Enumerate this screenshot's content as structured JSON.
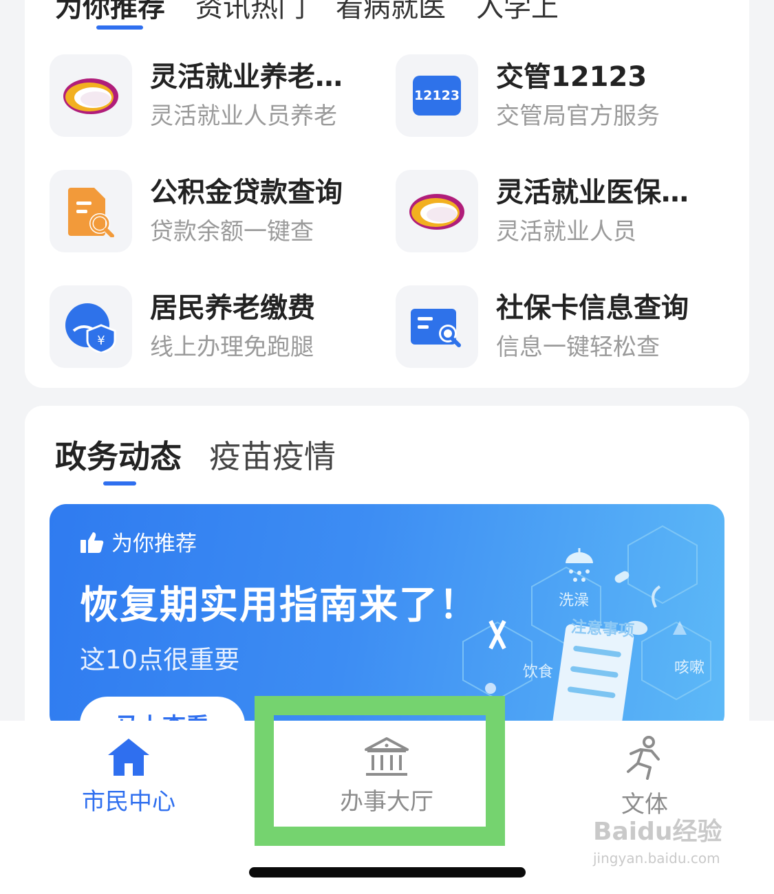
{
  "top_tabs": [
    {
      "label": "为你推荐",
      "active": true
    },
    {
      "label": "资讯热门",
      "active": false
    },
    {
      "label": "看病就医",
      "active": false
    },
    {
      "label": "入学上",
      "active": false
    }
  ],
  "services": [
    {
      "title": "灵活就业养老…",
      "subtitle": "灵活就业人员养老",
      "icon": "cloud-logo-icon"
    },
    {
      "title": "交管12123",
      "subtitle": "交管局官方服务",
      "icon": "traffic-12123-icon",
      "icon_text": "12123"
    },
    {
      "title": "公积金贷款查询",
      "subtitle": "贷款余额一键查",
      "icon": "document-search-icon"
    },
    {
      "title": "灵活就业医保…",
      "subtitle": "灵活就业人员",
      "icon": "cloud-logo-icon"
    },
    {
      "title": "居民养老缴费",
      "subtitle": "线上办理免跑腿",
      "icon": "elder-payment-icon"
    },
    {
      "title": "社保卡信息查询",
      "subtitle": "信息一键轻松查",
      "icon": "card-search-icon"
    }
  ],
  "news_tabs": [
    {
      "label": "政务动态",
      "active": true
    },
    {
      "label": "疫苗疫情",
      "active": false
    }
  ],
  "banner": {
    "recommend_label": "为你推荐",
    "title": "恢复期实用指南来了！",
    "subtitle": "这10点很重要",
    "button_label": "马上查看",
    "art_labels": {
      "notice": "注意事项",
      "bath": "洗澡",
      "diet": "饮食",
      "cough": "咳嗽"
    }
  },
  "tabbar": [
    {
      "label": "市民中心",
      "icon": "home-icon",
      "active": true
    },
    {
      "label": "办事大厅",
      "icon": "government-building-icon",
      "active": false
    },
    {
      "label": "文体",
      "icon": "running-person-icon",
      "active": false
    }
  ],
  "watermark": {
    "text": "Baidu经验",
    "url": "jingyan.baidu.com"
  },
  "colors": {
    "accent": "#2f6fef",
    "highlight": "#75d36f",
    "muted_text": "#9a9a9a"
  }
}
